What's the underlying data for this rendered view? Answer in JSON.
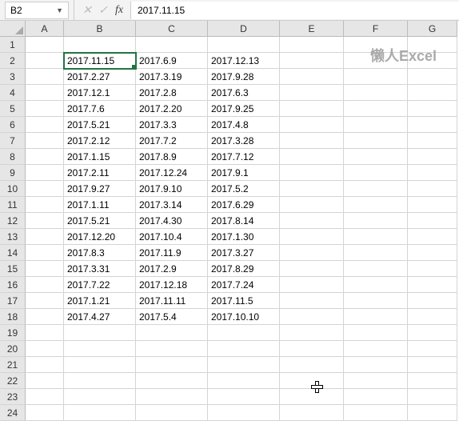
{
  "name_box": "B2",
  "formula_value": "2017.11.15",
  "watermark": "懒人Excel",
  "columns": [
    "A",
    "B",
    "C",
    "D",
    "E",
    "F",
    "G"
  ],
  "row_numbers": [
    1,
    2,
    3,
    4,
    5,
    6,
    7,
    8,
    9,
    10,
    11,
    12,
    13,
    14,
    15,
    16,
    17,
    18,
    19,
    20,
    21,
    22,
    23,
    24
  ],
  "active_cell": {
    "row": 2,
    "col": "B"
  },
  "chart_data": {
    "type": "table",
    "title": "",
    "columns": [
      "B",
      "C",
      "D"
    ],
    "rows": [
      {
        "row": 2,
        "B": "2017.11.15",
        "C": "2017.6.9",
        "D": "2017.12.13"
      },
      {
        "row": 3,
        "B": "2017.2.27",
        "C": "2017.3.19",
        "D": "2017.9.28"
      },
      {
        "row": 4,
        "B": "2017.12.1",
        "C": "2017.2.8",
        "D": "2017.6.3"
      },
      {
        "row": 5,
        "B": "2017.7.6",
        "C": "2017.2.20",
        "D": "2017.9.25"
      },
      {
        "row": 6,
        "B": "2017.5.21",
        "C": "2017.3.3",
        "D": "2017.4.8"
      },
      {
        "row": 7,
        "B": "2017.2.12",
        "C": "2017.7.2",
        "D": "2017.3.28"
      },
      {
        "row": 8,
        "B": "2017.1.15",
        "C": "2017.8.9",
        "D": "2017.7.12"
      },
      {
        "row": 9,
        "B": "2017.2.11",
        "C": "2017.12.24",
        "D": "2017.9.1"
      },
      {
        "row": 10,
        "B": "2017.9.27",
        "C": "2017.9.10",
        "D": "2017.5.2"
      },
      {
        "row": 11,
        "B": "2017.1.11",
        "C": "2017.3.14",
        "D": "2017.6.29"
      },
      {
        "row": 12,
        "B": "2017.5.21",
        "C": "2017.4.30",
        "D": "2017.8.14"
      },
      {
        "row": 13,
        "B": "2017.12.20",
        "C": "2017.10.4",
        "D": "2017.1.30"
      },
      {
        "row": 14,
        "B": "2017.8.3",
        "C": "2017.11.9",
        "D": "2017.3.27"
      },
      {
        "row": 15,
        "B": "2017.3.31",
        "C": "2017.2.9",
        "D": "2017.8.29"
      },
      {
        "row": 16,
        "B": "2017.7.22",
        "C": "2017.12.18",
        "D": "2017.7.24"
      },
      {
        "row": 17,
        "B": "2017.1.21",
        "C": "2017.11.11",
        "D": "2017.11.5"
      },
      {
        "row": 18,
        "B": "2017.4.27",
        "C": "2017.5.4",
        "D": "2017.10.10"
      }
    ]
  }
}
